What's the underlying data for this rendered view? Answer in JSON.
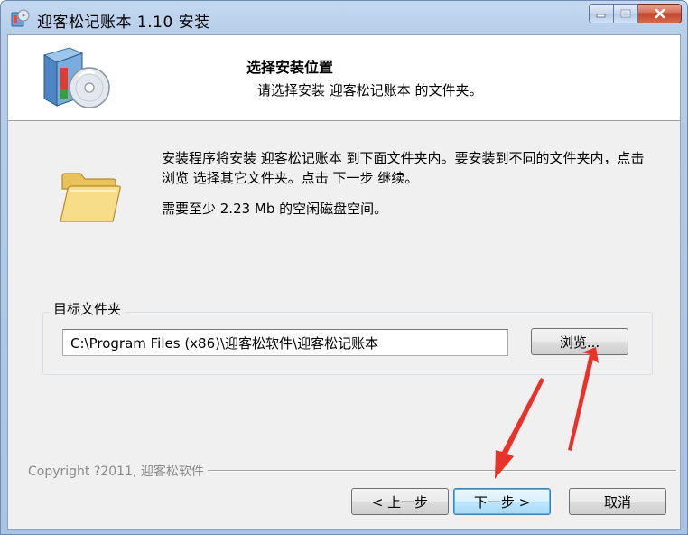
{
  "window": {
    "title": "迎客松记账本 1.10 安装",
    "controls": {
      "minimize": "minimize-button",
      "maximize": "maximize-button",
      "close": "close-button"
    }
  },
  "header": {
    "title": "选择安装位置",
    "subtitle": "请选择安装 迎客松记账本 的文件夹。"
  },
  "body": {
    "intro": "安装程序将安装 迎客松记账本 到下面文件夹内。要安装到不同的文件夹内，点击 浏览 选择其它文件夹。点击 下一步 继续。",
    "space_required": "需要至少 2.23 Mb 的空闲磁盘空间。"
  },
  "destination": {
    "group_label": "目标文件夹",
    "path_value": "C:\\Program Files (x86)\\迎客松软件\\迎客松记账本",
    "browse_label": "浏览..."
  },
  "footer": {
    "copyright": "Copyright ?2011, 迎客松软件",
    "back_label": "< 上一步",
    "next_label": "下一步 >",
    "cancel_label": "取消"
  },
  "colors": {
    "annotation_arrow": "#e8322a",
    "titlebar": "#b6cde9",
    "client_bg": "#f0f0f0"
  },
  "icons": [
    "installer-icon",
    "installer-box-graphic",
    "folder-icon",
    "red-arrow-annotation"
  ]
}
